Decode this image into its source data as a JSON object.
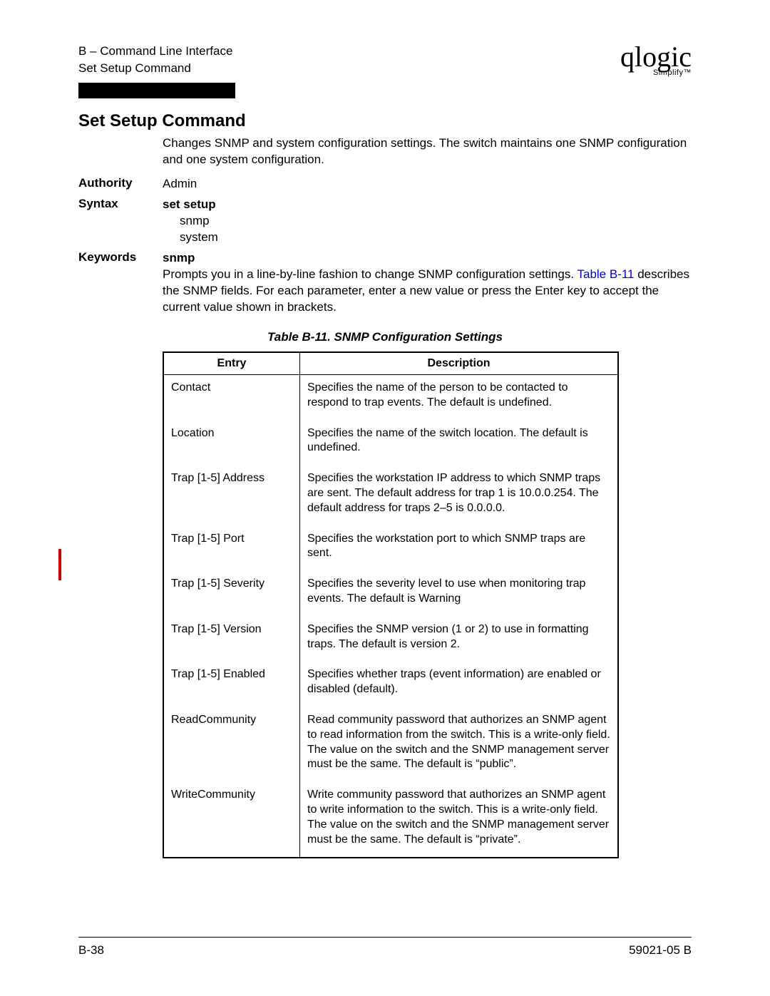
{
  "header": {
    "line1": "B – Command Line Interface",
    "line2": "Set Setup Command",
    "logo_main": "qlogic",
    "logo_sub": "Simplify™"
  },
  "title": "Set Setup Command",
  "intro": "Changes SNMP and system configuration settings. The switch maintains one SNMP configuration and one system configuration.",
  "authority": {
    "label": "Authority",
    "value": "Admin"
  },
  "syntax": {
    "label": "Syntax",
    "command": "set setup",
    "args": [
      "snmp",
      "system"
    ]
  },
  "keywords": {
    "label": "Keywords",
    "name": "snmp",
    "desc1": "Prompts you in a line-by-line fashion to change SNMP configuration settings. ",
    "table_ref": "Table B-11",
    "desc2": " describes the SNMP fields. For each parameter, enter a new value or press the Enter key to accept the current value shown in brackets."
  },
  "table": {
    "caption": "Table B-11. SNMP Configuration Settings",
    "col1": "Entry",
    "col2": "Description",
    "rows": [
      {
        "entry": "Contact",
        "desc": "Specifies the name of the person to be contacted to respond to trap events. The default is undefined."
      },
      {
        "entry": "Location",
        "desc": "Specifies the name of the switch location. The default is undefined."
      },
      {
        "entry": "Trap [1-5] Address",
        "desc": "Specifies the workstation IP address to which SNMP traps are sent. The default address for trap 1 is 10.0.0.254. The default address for traps 2–5 is 0.0.0.0."
      },
      {
        "entry": "Trap [1-5] Port",
        "desc": "Specifies the workstation port to which SNMP traps are sent."
      },
      {
        "entry": "Trap [1-5] Severity",
        "desc": "Specifies the severity level to use when monitoring trap events. The default is Warning"
      },
      {
        "entry": "Trap [1-5] Version",
        "desc": "Specifies the SNMP version (1 or 2) to use in formatting traps. The default is version 2."
      },
      {
        "entry": "Trap [1-5] Enabled",
        "desc": "Specifies whether traps (event information) are enabled or disabled (default)."
      },
      {
        "entry": "ReadCommunity",
        "desc": "Read community password that authorizes an SNMP agent to read information from the switch. This is a write-only field. The value on the switch and the SNMP management server must be the same. The default is “public”."
      },
      {
        "entry": "WriteCommunity",
        "desc": "Write community password that authorizes an SNMP agent to write information to the switch. This is a write-only field. The value on the switch and the SNMP management server must be the same. The default is “private”."
      }
    ]
  },
  "footer": {
    "left": "B-38",
    "right": "59021-05  B"
  }
}
